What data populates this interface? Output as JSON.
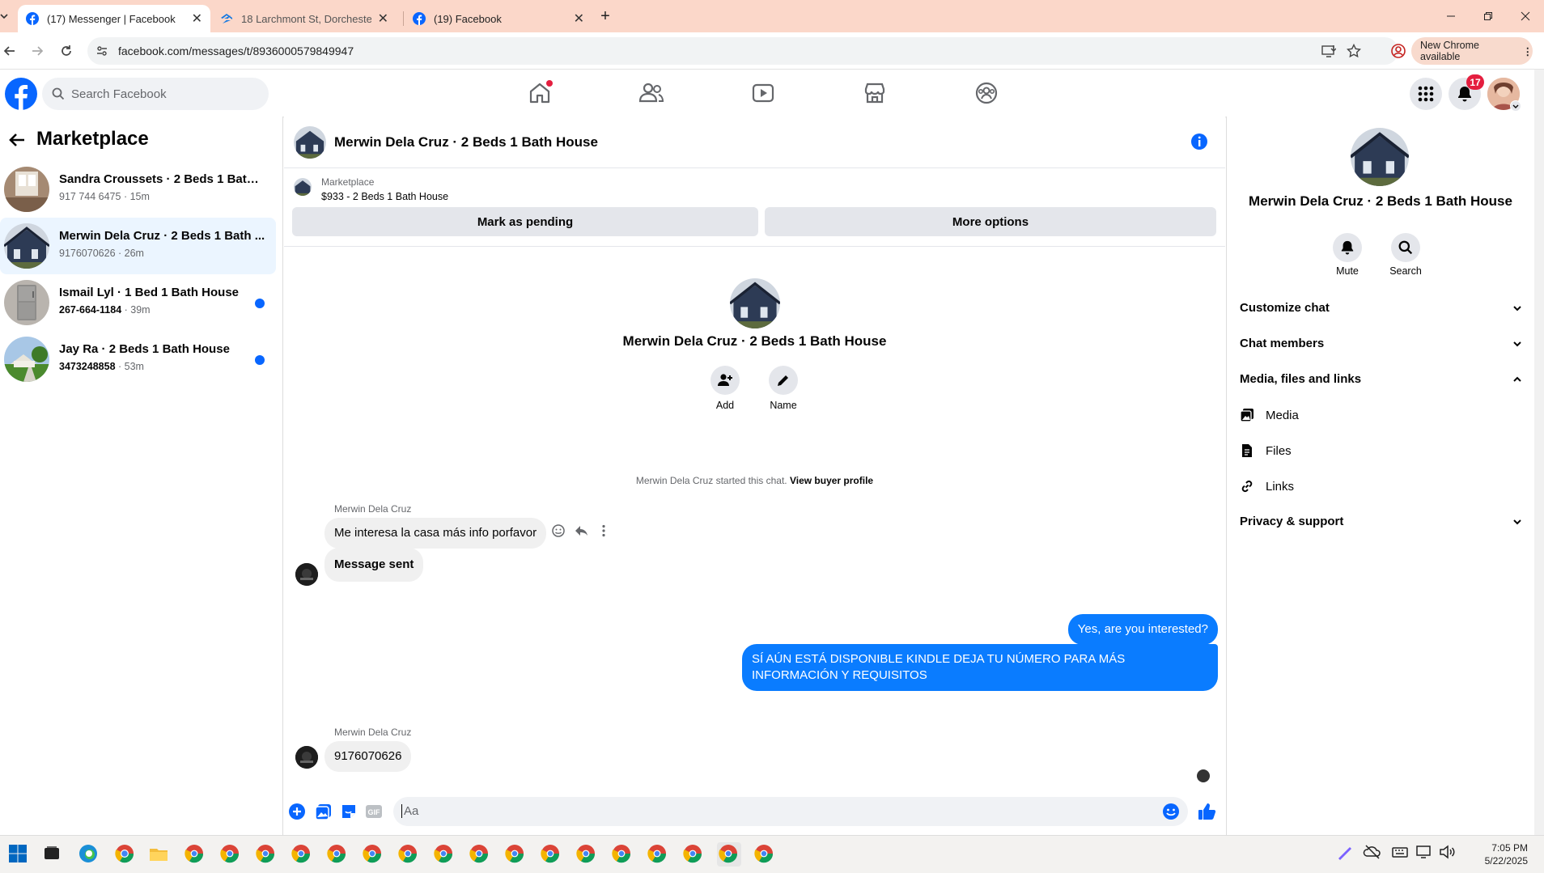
{
  "browser": {
    "tabs": [
      {
        "title": "(17) Messenger | Facebook",
        "icon": "facebook-icon",
        "active": true
      },
      {
        "title": "18 Larchmont St, Dorchester Ce",
        "icon": "zillow-icon",
        "active": false
      },
      {
        "title": "(19) Facebook",
        "icon": "facebook-icon",
        "active": false
      }
    ],
    "url": "facebook.com/messages/t/8936000579849947",
    "update_label": "New Chrome available"
  },
  "fb_header": {
    "search_placeholder": "Search Facebook",
    "notification_count": "17",
    "nav_icons": [
      "home-icon",
      "friends-icon",
      "video-icon",
      "marketplace-icon",
      "groups-icon"
    ]
  },
  "left_panel": {
    "title": "Marketplace",
    "conversations": [
      {
        "name": "Sandra Croussets · 2 Beds 1 Bath H...",
        "phone": "917 744 6475",
        "time": "15m",
        "unread": false,
        "selected": false
      },
      {
        "name": "Merwin Dela Cruz · 2 Beds 1 Bath ...",
        "phone": "9176070626",
        "time": "26m",
        "unread": false,
        "selected": true
      },
      {
        "name": "Ismail Lyl · 1 Bed 1 Bath House",
        "phone": "267-664-1184",
        "time": "39m",
        "unread": true,
        "selected": false
      },
      {
        "name": "Jay Ra · 2 Beds 1 Bath House",
        "phone": "3473248858",
        "time": "53m",
        "unread": true,
        "selected": false
      }
    ]
  },
  "chat": {
    "title": "Merwin Dela Cruz · 2 Beds 1 Bath House",
    "listing": {
      "source": "Marketplace",
      "price_title": "$933 - 2 Beds 1 Bath House",
      "mark_pending": "Mark as pending",
      "more_options": "More options"
    },
    "intro": {
      "name": "Merwin Dela Cruz · 2 Beds 1 Bath House",
      "add_label": "Add",
      "name_label": "Name",
      "started_text": "Merwin Dela Cruz started this chat.",
      "view_profile": "View buyer profile"
    },
    "messages": {
      "sender1": "Merwin Dela Cruz",
      "m1": "Me interesa la casa más info porfavor",
      "m2": "Message sent",
      "m3": "Yes, are you interested?",
      "m4": "SÍ AÚN ESTÁ DISPONIBLE KINDLE DEJA TU NÚMERO PARA MÁS INFORMACIÓN Y REQUISITOS",
      "sender2": "Merwin Dela Cruz",
      "m5": "9176070626"
    },
    "composer_placeholder": "Aa"
  },
  "right_panel": {
    "name": "Merwin Dela Cruz · 2 Beds 1 Bath House",
    "mute_label": "Mute",
    "search_label": "Search",
    "sections": {
      "customize": "Customize chat",
      "members": "Chat members",
      "media_files_links": "Media, files and links",
      "media": "Media",
      "files": "Files",
      "links": "Links",
      "privacy": "Privacy & support"
    }
  },
  "taskbar": {
    "time": "7:05 PM",
    "date": "5/22/2025"
  },
  "colors": {
    "fb_blue": "#0866ff",
    "messenger_blue": "#0a7cff",
    "tab_bar": "#fbd7c9",
    "badge_red": "#e41e3f"
  }
}
